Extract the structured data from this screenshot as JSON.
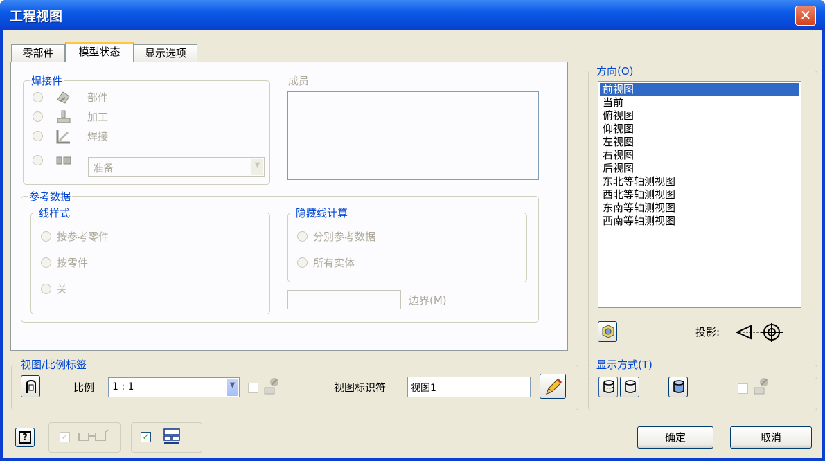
{
  "window": {
    "title": "工程视图"
  },
  "tabs": [
    "零部件",
    "模型状态",
    "显示选项"
  ],
  "weldment": {
    "title": "焊接件",
    "options": [
      "部件",
      "加工",
      "焊接"
    ],
    "prep_value": "准备"
  },
  "members": {
    "title": "成员"
  },
  "reference": {
    "title": "参考数据",
    "line_style": {
      "title": "线样式",
      "options": [
        "按参考零件",
        "按零件",
        "关"
      ]
    },
    "hidden_line": {
      "title": "隐藏线计算",
      "options": [
        "分别参考数据",
        "所有实体"
      ]
    },
    "boundary_label": "边界(M)"
  },
  "orientation": {
    "title": "方向(O)",
    "items": [
      "前视图",
      "当前",
      "俯视图",
      "仰视图",
      "左视图",
      "右视图",
      "后视图",
      "东北等轴测视图",
      "西北等轴测视图",
      "东南等轴测视图",
      "西南等轴测视图"
    ],
    "selected": 0,
    "projection_label": "投影:"
  },
  "view_label": {
    "title": "视图/比例标签",
    "scale_label": "比例",
    "scale_value": "1 : 1",
    "identifier_label": "视图标识符",
    "identifier_value": "视图1"
  },
  "display_style": {
    "title": "显示方式(T)"
  },
  "buttons": {
    "ok": "确定",
    "cancel": "取消"
  },
  "icons": [
    "close-icon",
    "assembly-icon",
    "machining-icon",
    "welds-icon",
    "preparation-icon",
    "camera-view-icon",
    "projection-icon",
    "label-visibility-icon",
    "edit-pencil-icon",
    "hidden-line-icon",
    "hidden-line-removed-icon",
    "shaded-icon",
    "raster-icon",
    "help-icon",
    "glasses-icon",
    "layout-icon"
  ]
}
